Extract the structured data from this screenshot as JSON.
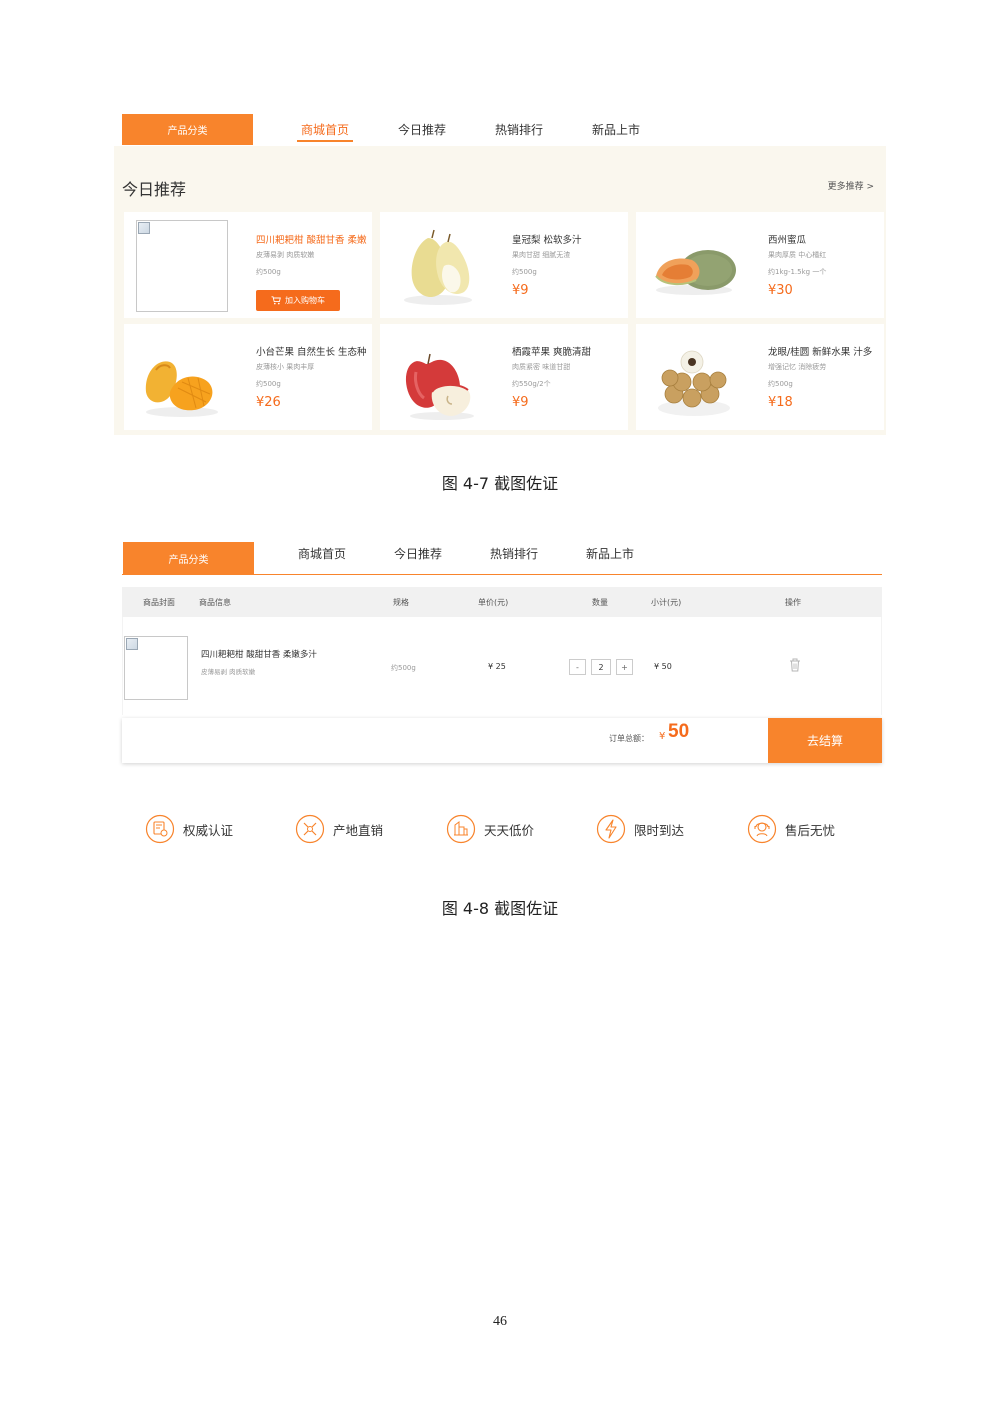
{
  "figure1": {
    "nav": {
      "category": "产品分类",
      "items": [
        "商城首页",
        "今日推荐",
        "热销排行",
        "新品上市"
      ],
      "active_index": 0
    },
    "section_title": "今日推荐",
    "more_link": "更多推荐 >",
    "products": [
      {
        "name": "四川耙耙柑 酸甜甘香 柔嫩",
        "desc": "皮薄易剥 肉质软嫩",
        "weight": "约500g",
        "price": "",
        "button": "加入购物车",
        "image": "broken-image-icon"
      },
      {
        "name": "皇冠梨 松软多汁",
        "desc": "果肉甘甜 细腻无渣",
        "weight": "约500g",
        "price": "¥9",
        "image": "pear-icon"
      },
      {
        "name": "西州蜜瓜",
        "desc": "果肉厚质 中心橘红",
        "weight": "约1kg-1.5kg 一个",
        "price": "¥30",
        "image": "melon-icon"
      },
      {
        "name": "小台芒果 自然生长 生态种",
        "desc": "皮薄核小 果肉丰厚",
        "weight": "约500g",
        "price": "¥26",
        "image": "mango-icon"
      },
      {
        "name": "栖霞苹果 爽脆清甜",
        "desc": "肉质紧密 味道甘甜",
        "weight": "约550g/2个",
        "price": "¥9",
        "image": "apple-icon"
      },
      {
        "name": "龙眼/桂圆 新鲜水果 汁多",
        "desc": "增强记忆 消除疲劳",
        "weight": "约500g",
        "price": "¥18",
        "image": "longan-icon"
      }
    ],
    "caption": "图 4-7   截图佐证"
  },
  "figure2": {
    "nav": {
      "category": "产品分类",
      "items": [
        "商城首页",
        "今日推荐",
        "热销排行",
        "新品上市"
      ]
    },
    "table": {
      "headers": [
        "商品封面",
        "商品信息",
        "规格",
        "单价(元)",
        "数量",
        "小计(元)",
        "操作"
      ],
      "row": {
        "name": "四川耙耙柑 酸甜甘香 柔嫩多汁",
        "desc": "皮薄易剥 肉质软嫩",
        "spec": "约500g",
        "unit_price": "¥ 25",
        "quantity": "2",
        "minus": "-",
        "plus": "+",
        "subtotal": "¥ 50"
      }
    },
    "total": {
      "label": "订单总额：",
      "currency": "¥",
      "value": "50",
      "checkout": "去结算"
    },
    "features": [
      {
        "label": "权威认证",
        "icon": "certificate-icon"
      },
      {
        "label": "产地直销",
        "icon": "origin-direct-icon"
      },
      {
        "label": "天天低价",
        "icon": "low-price-icon"
      },
      {
        "label": "限时到达",
        "icon": "lightning-icon"
      },
      {
        "label": "售后无忧",
        "icon": "customer-service-icon"
      }
    ],
    "caption": "图 4-8   截图佐证"
  },
  "page_number": "46",
  "colors": {
    "accent": "#f8842c",
    "price": "#f56b1c",
    "panel_bg": "#faf7ee"
  }
}
